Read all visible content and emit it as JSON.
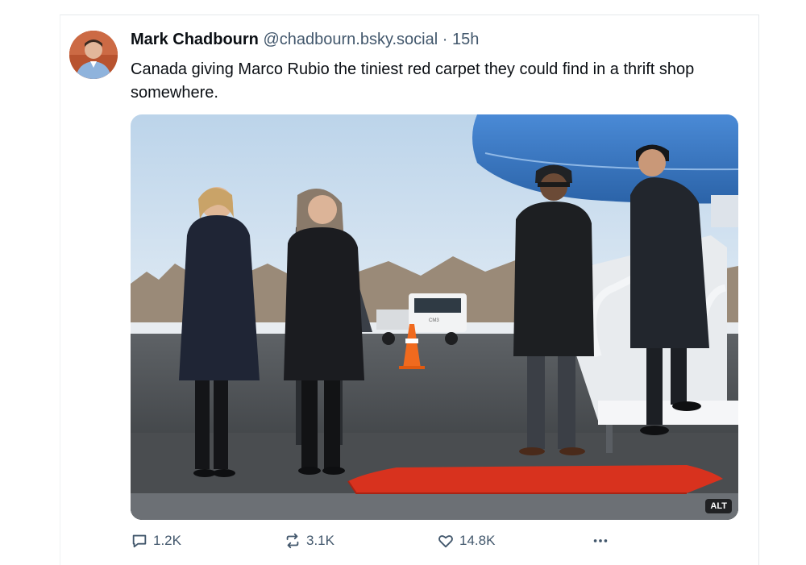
{
  "post": {
    "author_name": "Mark Chadbourn",
    "author_handle": "@chadbourn.bsky.social",
    "separator": " · ",
    "time": "15h",
    "text": "Canada giving Marco Rubio the tiniest red carpet they could find in a thrift shop somewhere."
  },
  "media": {
    "alt_badge": "ALT",
    "truck_label": "CM3"
  },
  "actions": {
    "reply_count": "1.2K",
    "repost_count": "3.1K",
    "like_count": "14.8K",
    "more_icon": "more-horizontal-icon"
  },
  "colors": {
    "text": "#0b0f14",
    "muted": "#42576c",
    "carpet": "#d8321e",
    "plane": "#3b7fce"
  }
}
